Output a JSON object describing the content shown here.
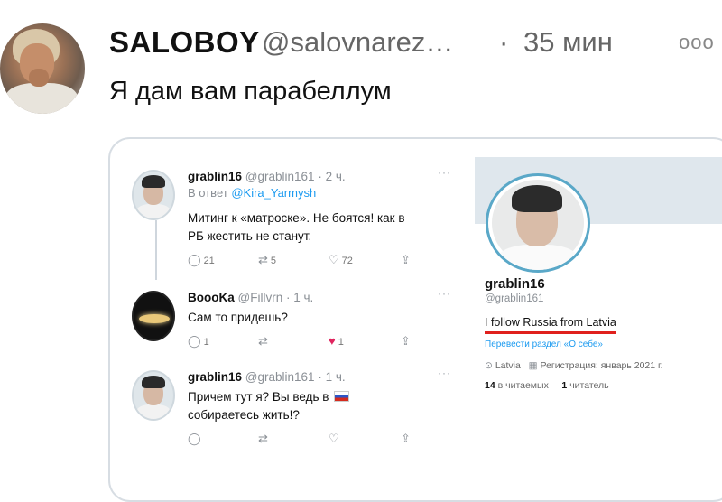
{
  "tweet": {
    "display_name": "SALOBOY",
    "handle": "@salovnarez…",
    "separator": "·",
    "time": "35 мин",
    "more_icon": "ooo",
    "text": "Я дам вам парабеллум"
  },
  "embedded": {
    "replies": [
      {
        "name": "grablin16",
        "handle": "@grablin161",
        "time": "· 2 ч.",
        "reply_to_prefix": "В ответ",
        "reply_to_mention": "@Kira_Yarmysh",
        "text_lines": [
          "Митинг к «матроске». Не боятся! как в",
          "РБ жестить не станут."
        ],
        "counts": {
          "replies": "21",
          "retweets": "5",
          "likes": "72"
        }
      },
      {
        "name": "BoooKa",
        "handle": "@Fillvrn",
        "time": "· 1 ч.",
        "text_lines": [
          "Сам то придешь?"
        ],
        "counts": {
          "replies": "1",
          "retweets": "",
          "likes": "1"
        }
      },
      {
        "name": "grablin16",
        "handle": "@grablin161",
        "time": "· 1 ч.",
        "text_lines": [
          "Причем тут я? Вы ведь в",
          "собираетесь жить!?"
        ],
        "counts": {
          "replies": "",
          "retweets": "",
          "likes": ""
        }
      }
    ],
    "profile": {
      "name": "grablin16",
      "handle": "@grablin161",
      "bio": "I follow Russia from Latvia",
      "translate": "Перевести раздел «О себе»",
      "location": "Latvia",
      "joined": "Регистрация: январь 2021 г.",
      "following_count": "14",
      "following_label": "в читаемых",
      "followers_count": "1",
      "followers_label": "читатель"
    }
  },
  "colors": {
    "accent": "#1d9bf0",
    "like": "#e0245e",
    "underline": "#e0201d"
  }
}
